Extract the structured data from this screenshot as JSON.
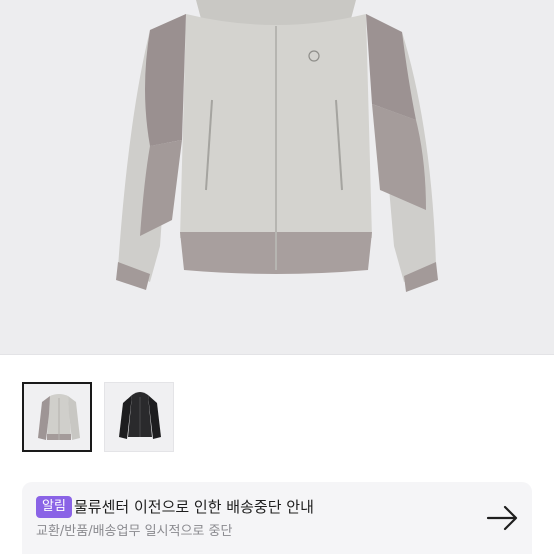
{
  "product": {
    "main_image": "gray-hooded-jacket-photo",
    "thumbnails": [
      {
        "label": "light-gray-jacket",
        "selected": true
      },
      {
        "label": "black-jacket",
        "selected": false
      }
    ]
  },
  "notice": {
    "badge": "알림",
    "title": "물류센터 이전으로 인한 배송중단 안내",
    "subtitle": "교환/반품/배송업무 일시적으로 중단",
    "badge_color": "#8a63e6",
    "arrow_icon": "arrow-right-icon"
  }
}
